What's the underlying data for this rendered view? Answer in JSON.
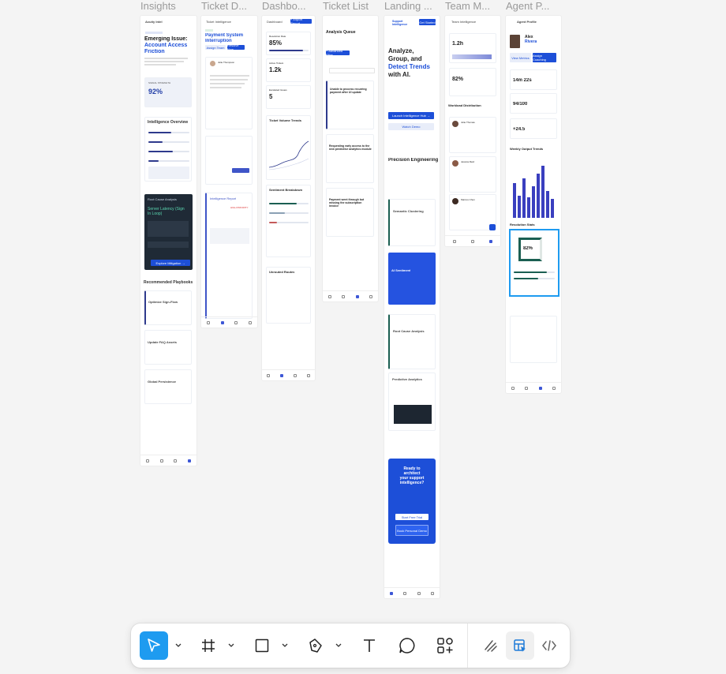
{
  "frames": [
    {
      "label": "Insights",
      "header": "Acuity Intel",
      "title_1": "Emerging Issue:",
      "title_2": "Account Access",
      "title_3": "Friction",
      "metric_label": "SIGNAL STRENGTH",
      "metric": "92%",
      "section_1": "Intelligence Overview",
      "dark_title": "Root Cause Analysis",
      "dark_head_1": "Server Latency (Sign",
      "dark_head_2": "In Loop)",
      "dark_button": "Explore Mitigation →",
      "section_2": "Recommended Playbooks",
      "pb_1": "Optimize Sign-Flow",
      "pb_2": "Update FAQ Assets",
      "pb_3": "Global Persistence"
    },
    {
      "label": "Ticket D...",
      "header": "Ticket Intelligence",
      "badge": "ACTIVE",
      "title_1": "Payment System",
      "title_2": "Interruption",
      "tag": "Assign Team",
      "tag_2": "Resolve Now",
      "agent": "Julie Thompson",
      "quote": "\"Unable to process recurring payment after upgrade\"",
      "side_title": "Intelligence Report",
      "priority": "HIGH PRIORITY"
    },
    {
      "label": "Dashbo...",
      "header": "Dashboard",
      "button": "+ Export Report",
      "m1_label": "Resolution Rate",
      "m1": "85%",
      "m2_label": "Active Tickets",
      "m2": "1.2k",
      "m3_label": "Escalated Issues",
      "m3": "5",
      "chart_title": "Ticket Volume Trends",
      "sent_title": "Sentiment Breakdown",
      "unrouted": "Unrouted Routes"
    },
    {
      "label": "Ticket List",
      "title": "Analysis Queue",
      "filter": "+ Advanced Filter",
      "t1": "Unable to process recurring payment after UI update",
      "t2": "Requesting early access to the new predictive analytics module",
      "t3": "Payment went through but missing the subscription invoice"
    },
    {
      "label": "Landing ...",
      "logo": "Support Intelligence",
      "cta_top": "Get Started",
      "hero_1": "Analyze,",
      "hero_2": "Group, and",
      "hero_3": "Detect Trends",
      "hero_4": "with AI.",
      "btn_1": "Launch Intelligence Hub →",
      "btn_2": "Watch Demo",
      "section": "Precision Engineering",
      "f1": "Semantic Clustering",
      "f2": "AI Sentiment",
      "f3": "Root Cause Analysis",
      "f4": "Predictive Analytics",
      "cta_1": "Ready to",
      "cta_2": "architect",
      "cta_3": "your support",
      "cta_4": "intelligence?",
      "cta_btn_1": "Start Free Trial",
      "cta_btn_2": "Book Personal Demo"
    },
    {
      "label": "Team M...",
      "header": "Team Intelligence",
      "m1": "1.2h",
      "m2": "82%",
      "section": "Workload Distribution",
      "a1": "Julie Thomas",
      "a2": "Jessica Reid",
      "a3": "Marcus Chen"
    },
    {
      "label": "Agent P...",
      "header": "Agent Profile",
      "name_1": "Alex",
      "name_2": "Rivera",
      "btn_1": "View Metrics",
      "btn_2": "Assign Coaching",
      "m1": "14m 22s",
      "m2": "94/100",
      "m3": "+24.5",
      "section": "Resolution Stats",
      "donut_label": "82%",
      "trend": "Weekly Output Trends"
    }
  ],
  "toolbar": {
    "tools": [
      "move-tool",
      "frame-tool",
      "shape-tool",
      "pen-tool",
      "text-tool",
      "comment-tool",
      "actions-tool"
    ],
    "right_tools": [
      "draw-mode",
      "design-mode",
      "dev-mode"
    ],
    "accent": "#1e9bf0"
  }
}
